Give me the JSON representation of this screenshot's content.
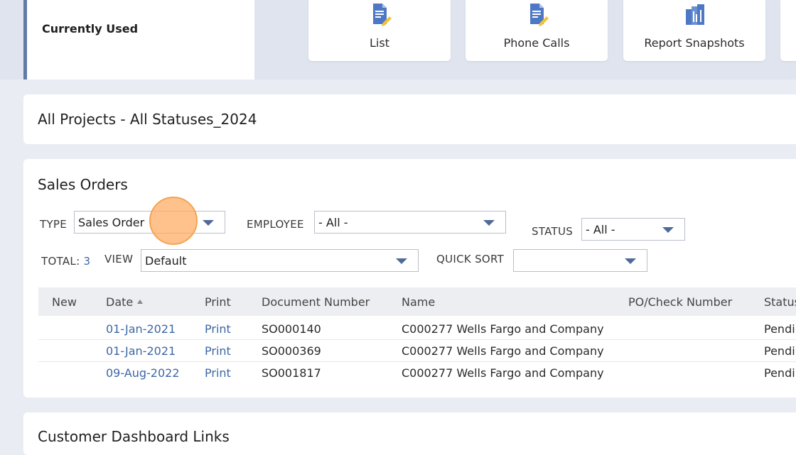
{
  "currently_used": {
    "label": "Currently Used"
  },
  "shortcuts": [
    {
      "label": "List",
      "icon": "document-pencil-icon"
    },
    {
      "label": "Phone Calls",
      "icon": "document-pencil-icon"
    },
    {
      "label": "Report Snapshots",
      "icon": "report-snapshots-icon"
    }
  ],
  "saved_search": {
    "title": "All Projects - All Statuses_2024"
  },
  "sales_orders": {
    "title": "Sales Orders",
    "type_label": "TYPE",
    "type_value": "Sales Order",
    "employee_label": "EMPLOYEE",
    "employee_value": "- All -",
    "status_label": "STATUS",
    "status_value": "- All -",
    "total_label": "TOTAL:",
    "total_value": "3",
    "view_label": "VIEW",
    "view_value": "Default",
    "quick_sort_label": "QUICK SORT",
    "quick_sort_value": "",
    "columns": [
      "New",
      "Date",
      "Print",
      "Document Number",
      "Name",
      "PO/Check Number",
      "Status"
    ],
    "rows": [
      {
        "date": "01-Jan-2021",
        "print": "Print",
        "doc": "SO000140",
        "name": "C000277 Wells Fargo and Company",
        "po": "",
        "status": "Pending"
      },
      {
        "date": "01-Jan-2021",
        "print": "Print",
        "doc": "SO000369",
        "name": "C000277 Wells Fargo and Company",
        "po": "",
        "status": "Pending"
      },
      {
        "date": "09-Aug-2022",
        "print": "Print",
        "doc": "SO001817",
        "name": "C000277 Wells Fargo and Company",
        "po": "",
        "status": "Pending"
      }
    ]
  },
  "dashboard_links": {
    "title": "Customer Dashboard Links"
  },
  "colors": {
    "accent": "#5f7ba6",
    "link": "#3c67a5",
    "icon_blue": "#4f78c4",
    "pencil": "#f3c13a"
  }
}
